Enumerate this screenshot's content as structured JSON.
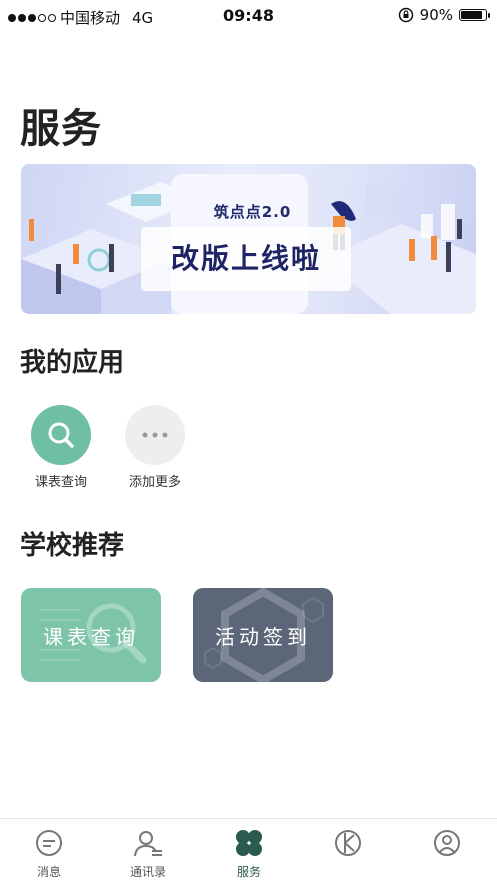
{
  "status_bar": {
    "carrier": "中国移动",
    "network": "4G",
    "time": "09:48",
    "battery": "90%",
    "battery_level": 0.9,
    "signal_bars": 3,
    "signal_total": 5
  },
  "page": {
    "title": "服务"
  },
  "banner": {
    "subtitle": "筑点点2.0",
    "headline": "改版上线啦"
  },
  "my_apps": {
    "title": "我的应用",
    "items": [
      {
        "label": "课表查询",
        "icon": "search-icon",
        "color": "#6fc0a3"
      },
      {
        "label": "添加更多",
        "icon": "more-icon",
        "color": "#eeeeee"
      }
    ]
  },
  "recommend": {
    "title": "学校推荐",
    "cards": [
      {
        "label": "课表查询",
        "color": "#7dc4a9"
      },
      {
        "label": "活动签到",
        "color": "#5b6679"
      }
    ]
  },
  "tabbar": {
    "items": [
      {
        "label": "消息",
        "icon": "message-icon"
      },
      {
        "label": "通讯录",
        "icon": "contacts-icon"
      },
      {
        "label": "服务",
        "icon": "services-icon",
        "active": true
      },
      {
        "label": "",
        "icon": "discover-icon"
      },
      {
        "label": "",
        "icon": "profile-icon"
      }
    ],
    "active_color": "#2b5a50"
  }
}
